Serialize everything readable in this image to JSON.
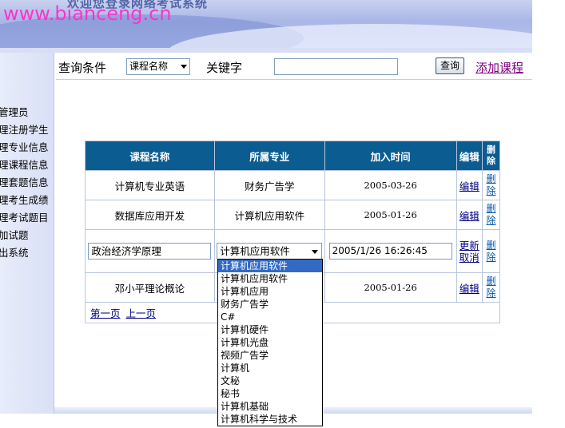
{
  "header": {
    "title": "欢迎您登录网络考试系统",
    "watermark": "www.bianceng.cn"
  },
  "sidebar": {
    "items": [
      {
        "label": "管理员"
      },
      {
        "label": "理注册学生"
      },
      {
        "label": "理专业信息"
      },
      {
        "label": "理课程信息"
      },
      {
        "label": "理套题信息"
      },
      {
        "label": "理考生成绩"
      },
      {
        "label": "理考试题目"
      },
      {
        "label": "加试题"
      },
      {
        "label": "出系统"
      }
    ]
  },
  "search": {
    "condition_label": "查询条件",
    "field_value": "课程名称",
    "keyword_label": "关键字",
    "keyword_value": "",
    "query_button": "查询",
    "add_course_link": "添加课程"
  },
  "table": {
    "headers": {
      "name": "课程名称",
      "major": "所属专业",
      "time": "加入时间",
      "edit": "编辑",
      "delete": "删除"
    },
    "rows": [
      {
        "name": "计算机专业英语",
        "major": "财务广告学",
        "time": "2005-03-26",
        "edit": "编辑",
        "delete": "删除"
      },
      {
        "name": "数据库应用开发",
        "major": "计算机应用软件",
        "time": "2005-01-26",
        "edit": "编辑",
        "delete": "删除"
      },
      {
        "name": "政治经济学原理",
        "major": "计算机应用软件",
        "time": "2005/1/26 16:26:45",
        "update": "更新",
        "cancel": "取消",
        "delete": "删除"
      },
      {
        "name": "邓小平理论概论",
        "major": "",
        "time": "2005-01-26",
        "edit": "编辑",
        "delete": "删除"
      }
    ],
    "pager": {
      "first": "第一页",
      "prev": "上一页"
    }
  },
  "major_dropdown": {
    "selected": "计算机应用软件",
    "options": [
      "计算机应用软件",
      "计算机应用软件",
      "计算机应用",
      "财务广告学",
      "C#",
      "计算机硬件",
      "计算机光盘",
      "视频广告学",
      "计算机",
      "文秘",
      "秘书",
      "计算机基础",
      "计算机科学与技术"
    ]
  },
  "colors": {
    "table_header_bg": "#0b5c91",
    "visited_link": "#800080",
    "link": "#000080",
    "dropdown_highlight": "#316ac5",
    "watermark": "#ff33cc"
  }
}
